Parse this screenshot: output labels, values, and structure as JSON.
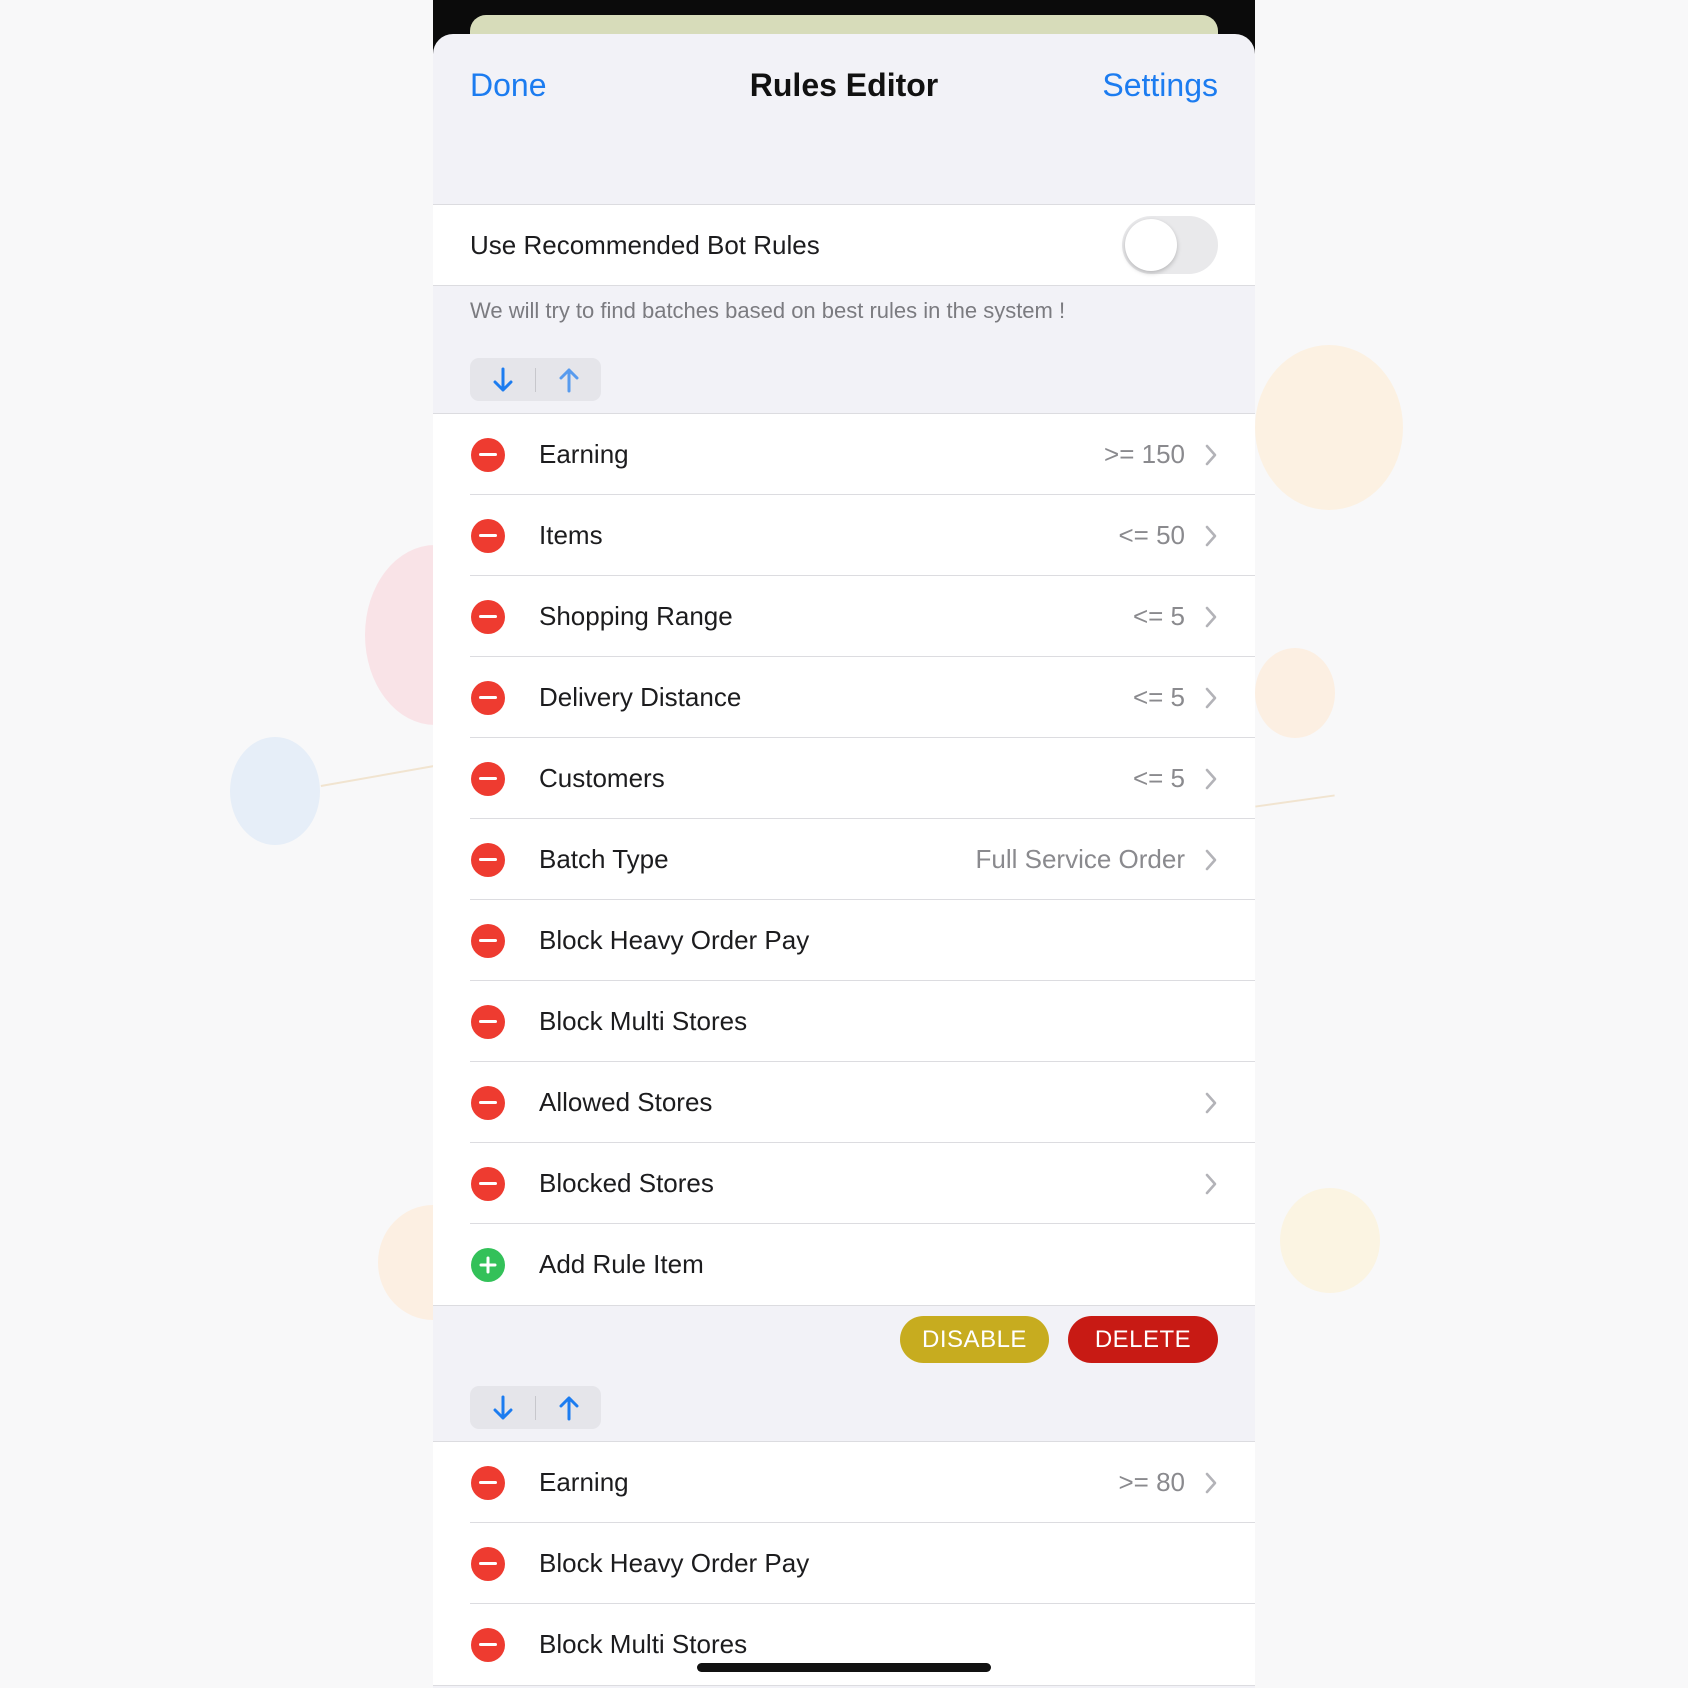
{
  "nav": {
    "left": "Done",
    "title": "Rules Editor",
    "right": "Settings"
  },
  "bot_rules": {
    "label": "Use Recommended Bot Rules",
    "enabled": false,
    "footnote": "We will try to find batches based on best rules in the system !"
  },
  "icons": {
    "move_down": "arrow-down-icon",
    "move_up": "arrow-up-icon",
    "remove": "minus-circle-icon",
    "add": "plus-circle-icon",
    "disclosure": "chevron-right-icon"
  },
  "colors": {
    "accent": "#1c7cf0",
    "remove": "#ee3b30",
    "add": "#33c159",
    "disable": "#c7ac1f",
    "delete": "#c81a14"
  },
  "rule_set_1": {
    "items": [
      {
        "label": "Earning",
        "value": ">= 150"
      },
      {
        "label": "Items",
        "value": "<= 50"
      },
      {
        "label": "Shopping Range",
        "value": "<= 5"
      },
      {
        "label": "Delivery Distance",
        "value": "<= 5"
      },
      {
        "label": "Customers",
        "value": "<= 5"
      },
      {
        "label": "Batch Type",
        "value": "Full Service Order"
      },
      {
        "label": "Block Heavy Order Pay"
      },
      {
        "label": "Block Multi Stores"
      },
      {
        "label": "Allowed Stores"
      },
      {
        "label": "Blocked Stores"
      }
    ],
    "add_label": "Add Rule Item",
    "disable_label": "DISABLE",
    "delete_label": "DELETE"
  },
  "rule_set_2": {
    "items": [
      {
        "label": "Earning",
        "value": ">= 80"
      },
      {
        "label": "Block Heavy Order Pay"
      },
      {
        "label": "Block Multi Stores"
      }
    ]
  }
}
